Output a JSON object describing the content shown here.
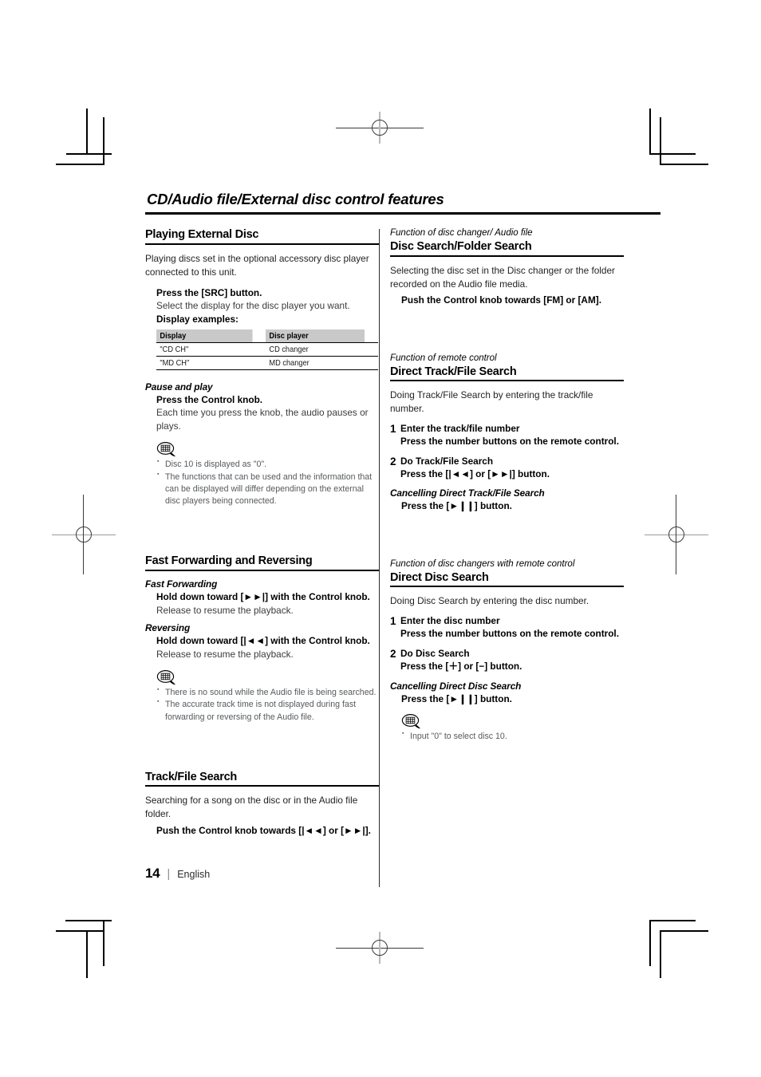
{
  "page": {
    "title": "CD/Audio file/External disc control features",
    "number": "14",
    "separator": "|",
    "language": "English"
  },
  "left_column": {
    "section1": {
      "heading": "Playing External Disc",
      "intro": "Playing discs set in the optional accessory disc player connected to this unit.",
      "instruction": "Press the [SRC] button.",
      "instruction_note": "Select the display for the disc player you want.",
      "table_label": "Display examples:",
      "table": {
        "headers": [
          "Display",
          "Disc player"
        ],
        "rows": [
          [
            "\"CD CH\"",
            "CD changer"
          ],
          [
            "\"MD CH\"",
            "MD changer"
          ]
        ]
      },
      "subsection": {
        "heading": "Pause and play",
        "instruction": "Press the Control knob.",
        "note": "Each time you press the knob, the audio pauses or plays.",
        "notes_icon": "note-bubble-icon",
        "notes": [
          "Disc 10 is displayed as \"0\".",
          "The functions that can be used and the information that can be displayed will differ depending on the external disc players being connected."
        ]
      }
    },
    "section2": {
      "heading": "Fast Forwarding and Reversing",
      "fast_forward": {
        "heading": "Fast Forwarding",
        "instruction": "Hold down toward [►►|] with the Control knob.",
        "note": "Release to resume the playback."
      },
      "reversing": {
        "heading": "Reversing",
        "instruction": "Hold down toward [|◄◄] with the Control knob.",
        "note": "Release to resume the playback."
      },
      "notes_icon": "note-bubble-icon",
      "notes": [
        "There is no sound while the Audio file is being searched.",
        "The accurate track time is not displayed during fast forwarding or reversing of the Audio file."
      ]
    },
    "section3": {
      "heading": "Track/File Search",
      "intro": "Searching for a song on the disc or in the Audio file folder.",
      "instruction": "Push the Control knob towards [|◄◄] or [►►|]."
    }
  },
  "right_column": {
    "section1": {
      "kicker": "Function of disc changer/ Audio file",
      "heading": "Disc Search/Folder Search",
      "intro": "Selecting the disc set in the Disc changer or the folder recorded on the Audio file media.",
      "instruction": "Push the Control knob towards [FM] or [AM]."
    },
    "section2": {
      "kicker": "Function of remote control",
      "heading": "Direct Track/File Search",
      "intro": "Doing Track/File Search by entering the track/file number.",
      "steps": [
        {
          "number": "1",
          "title": "Enter the track/file number",
          "text": "Press the number buttons on the remote control."
        },
        {
          "number": "2",
          "title": "Do Track/File Search",
          "text": "Press the [|◄◄] or [►►|] button."
        }
      ],
      "cancel_heading": "Cancelling Direct Track/File Search",
      "cancel_instruction": "Press the [►❙❙] button."
    },
    "section3": {
      "kicker": "Function of disc changers with remote control",
      "heading": "Direct Disc Search",
      "intro": "Doing Disc Search by entering the disc number.",
      "steps": [
        {
          "number": "1",
          "title": "Enter the disc number",
          "text": "Press the number buttons on the remote control."
        },
        {
          "number": "2",
          "title": "Do Disc Search",
          "text": "Press the [＋] or [−] button."
        }
      ],
      "cancel_heading": "Cancelling Direct Disc Search",
      "cancel_instruction": "Press the [►❙❙] button.",
      "notes_icon": "note-bubble-icon",
      "notes": [
        "Input \"0\" to select disc 10."
      ]
    }
  }
}
